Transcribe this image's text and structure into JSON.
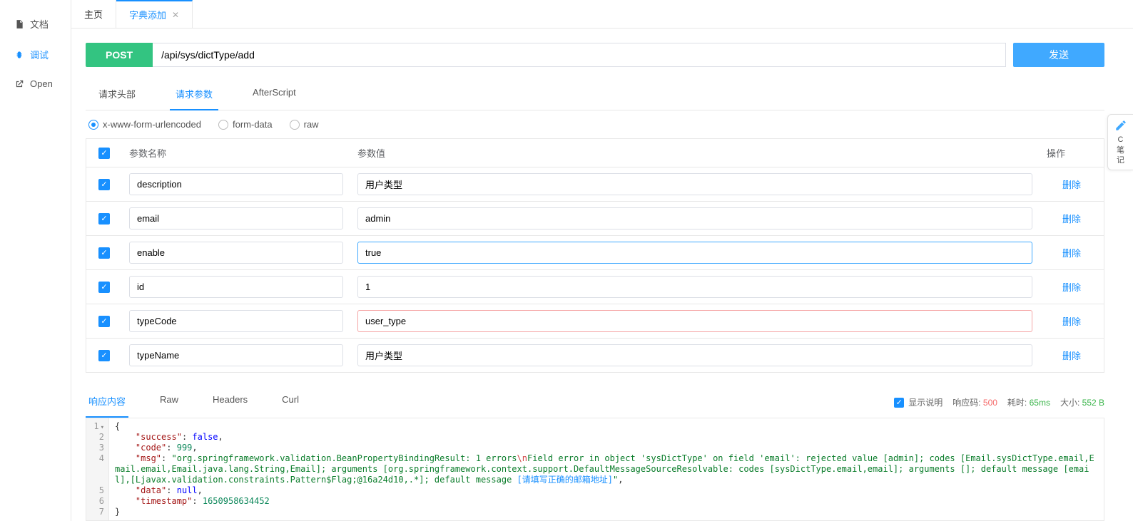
{
  "tabs": [
    {
      "label": "主页",
      "active": false,
      "closable": false
    },
    {
      "label": "字典添加",
      "active": true,
      "closable": true
    }
  ],
  "sidebar": [
    {
      "label": "文档",
      "icon": "doc-icon",
      "active": false
    },
    {
      "label": "调试",
      "icon": "bug-icon",
      "active": true
    },
    {
      "label": "Open",
      "icon": "open-icon",
      "active": false
    }
  ],
  "request": {
    "method": "POST",
    "url": "/api/sys/dictType/add",
    "send_label": "发送"
  },
  "req_tabs": [
    {
      "label": "请求头部",
      "active": false
    },
    {
      "label": "请求参数",
      "active": true
    },
    {
      "label": "AfterScript",
      "active": false
    }
  ],
  "body_types": [
    {
      "label": "x-www-form-urlencoded",
      "active": true
    },
    {
      "label": "form-data",
      "active": false
    },
    {
      "label": "raw",
      "active": false
    }
  ],
  "params_cols": {
    "name": "参数名称",
    "value": "参数值",
    "op": "操作"
  },
  "params": [
    {
      "checked": true,
      "name": "description",
      "value": "用户类型",
      "state": ""
    },
    {
      "checked": true,
      "name": "email",
      "value": "admin",
      "state": ""
    },
    {
      "checked": true,
      "name": "enable",
      "value": "true",
      "state": "focused"
    },
    {
      "checked": true,
      "name": "id",
      "value": "1",
      "state": ""
    },
    {
      "checked": true,
      "name": "typeCode",
      "value": "user_type",
      "state": "invalid"
    },
    {
      "checked": true,
      "name": "typeName",
      "value": "用户类型",
      "state": ""
    }
  ],
  "delete_label": "删除",
  "resp_tabs": [
    {
      "label": "响应内容",
      "active": true
    },
    {
      "label": "Raw",
      "active": false
    },
    {
      "label": "Headers",
      "active": false
    },
    {
      "label": "Curl",
      "active": false
    }
  ],
  "resp_meta": {
    "show_desc_label": "显示说明",
    "code_label": "响应码:",
    "code_value": "500",
    "time_label": "耗时:",
    "time_value": "65ms",
    "size_label": "大小:",
    "size_value": "552 B"
  },
  "resp_json": {
    "success": "false",
    "code": "999",
    "msg_prefix": "\"org.springframework.validation.BeanPropertyBindingResult: 1 errors",
    "msg_esc": "\\n",
    "msg_mid": "Field error in object 'sysDictType' on field 'email': rejected value [admin]; codes [Email.sysDictType.email,Email.email,Email.java.lang.String,Email]; arguments [org.springframework.context.support.DefaultMessageSourceResolvable: codes [sysDictType.email,email]; arguments []; default message [email],[Ljavax.validation.constraints.Pattern$Flag;@16a24d10,.*]; default message ",
    "msg_highlight": "[请填写正确的邮箱地址]",
    "msg_suffix": "\"",
    "data": "null",
    "timestamp": "1650958634452"
  },
  "gutter_lines": [
    "1",
    "2",
    "3",
    "4",
    "5",
    "6",
    "7"
  ],
  "float_widget": {
    "line1": "C",
    "line2": "笔",
    "line3": "记"
  }
}
